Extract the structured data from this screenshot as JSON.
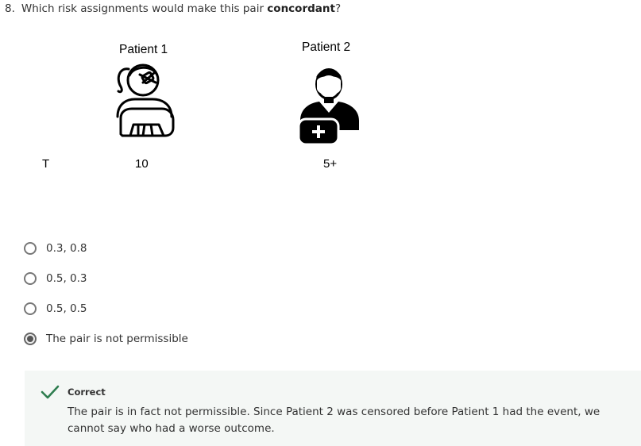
{
  "question": {
    "number": "8.",
    "text_before": "Which risk assignments would make this pair ",
    "text_bold": "concordant",
    "text_after": "?"
  },
  "patients": [
    {
      "label": "Patient 1",
      "time": "10",
      "icon": "female-patient-arm-sling-icon"
    },
    {
      "label": "Patient 2",
      "time": "5+",
      "icon": "male-patient-arm-sling-icon"
    }
  ],
  "row_label": "T",
  "options": [
    {
      "label": "0.3, 0.8",
      "selected": false
    },
    {
      "label": "0.5, 0.3",
      "selected": false
    },
    {
      "label": "0.5, 0.5",
      "selected": false
    },
    {
      "label": "The pair is not permissible",
      "selected": true
    }
  ],
  "feedback": {
    "status": "Correct",
    "icon": "checkmark-icon",
    "color": "#2e7d4f",
    "text": "The pair is in fact not permissible. Since Patient 2 was censored before Patient 1 had the event, we cannot say who had a worse outcome."
  }
}
